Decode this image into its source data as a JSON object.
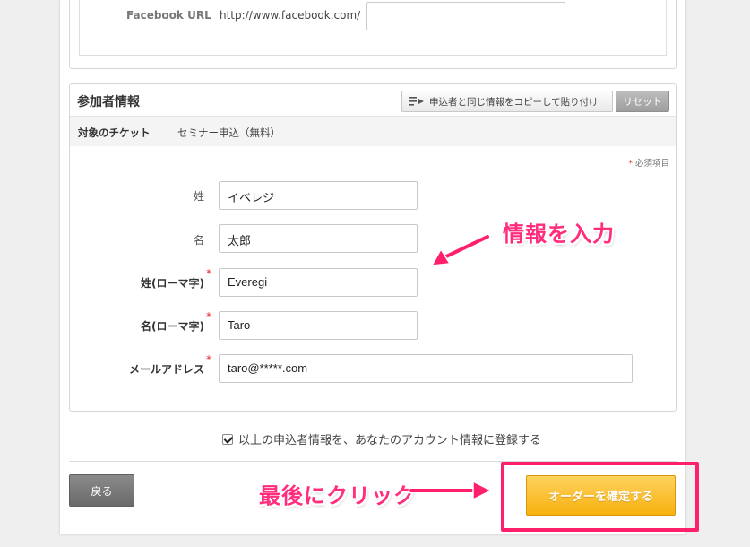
{
  "facebook": {
    "label": "Facebook URL",
    "prefix": "http://www.facebook.com/",
    "value": ""
  },
  "attendee": {
    "title": "参加者情報",
    "copy_button": "申込者と同じ情報をコピーして貼り付け",
    "reset_button": "リセット",
    "ticket_label": "対象のチケット",
    "ticket_value": "セミナー申込（無料）",
    "required_note": "必須項目",
    "required_mark": "*",
    "fields": [
      {
        "label": "姓",
        "value": "イベレジ",
        "required": false
      },
      {
        "label": "名",
        "value": "太郎",
        "required": false
      },
      {
        "label": "姓(ローマ字)",
        "value": "Everegi",
        "required": true
      },
      {
        "label": "名(ローマ字)",
        "value": "Taro",
        "required": true
      },
      {
        "label": "メールアドレス",
        "value": "taro@*****.com",
        "required": true
      }
    ]
  },
  "consent": {
    "label": "以上の申込者情報を、あなたのアカウント情報に登録する",
    "checked": true
  },
  "footer": {
    "back_button": "戻る",
    "confirm_button": "オーダーを確定する"
  },
  "annotations": {
    "enter_info": "情報を入力",
    "click_last": "最後にクリック"
  },
  "colors": {
    "accent_pink": "#ff1f6b",
    "confirm_orange": "#f7b10f",
    "required_red": "#e3262f"
  }
}
